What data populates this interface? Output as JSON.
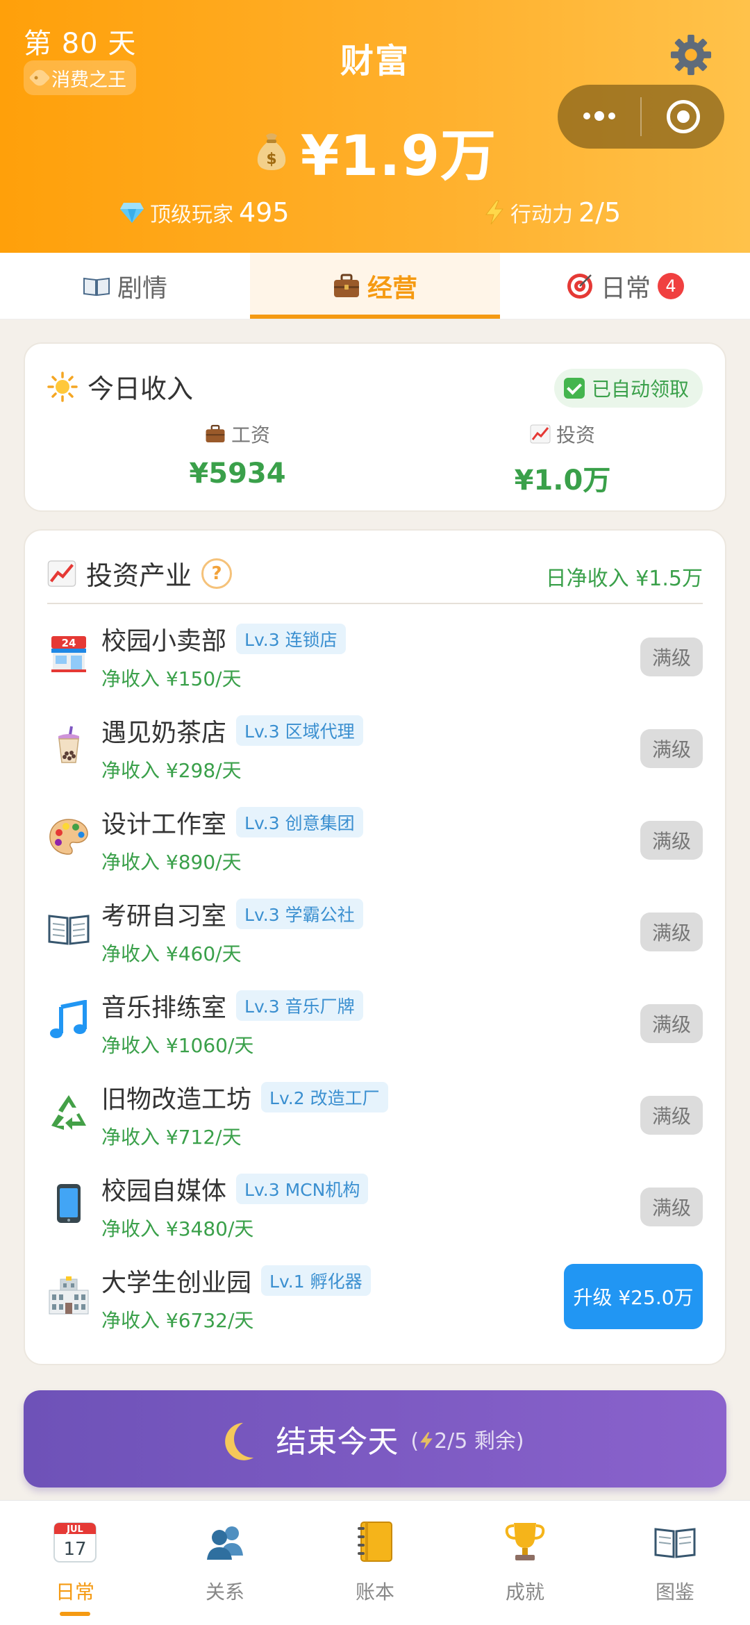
{
  "header": {
    "day_label": "第 80 天",
    "title_badge": "消费之王",
    "page_title": "财富",
    "money": "¥1.9万",
    "stat_left_label": "顶级玩家",
    "stat_left_value": "495",
    "stat_right_label": "行动力",
    "stat_right_value": "2/5"
  },
  "tabs": [
    {
      "label": "剧情",
      "icon": "book-icon"
    },
    {
      "label": "经营",
      "icon": "briefcase-icon",
      "active": true
    },
    {
      "label": "日常",
      "icon": "target-icon",
      "badge": "4"
    }
  ],
  "income": {
    "title": "今日收入",
    "auto_badge": "已自动领取",
    "salary_label": "工资",
    "salary_value": "¥5934",
    "invest_label": "投资",
    "invest_value": "¥1.0万"
  },
  "invest": {
    "title": "投资产业",
    "help": "?",
    "net_income": "日净收入 ¥1.5万",
    "items": [
      {
        "name": "校园小卖部",
        "level": "Lv.3 连锁店",
        "income": "净收入 ¥150/天",
        "action": "满级",
        "icon": "store-icon"
      },
      {
        "name": "遇见奶茶店",
        "level": "Lv.3 区域代理",
        "income": "净收入 ¥298/天",
        "action": "满级",
        "icon": "bubble-tea-icon"
      },
      {
        "name": "设计工作室",
        "level": "Lv.3 创意集团",
        "income": "净收入 ¥890/天",
        "action": "满级",
        "icon": "palette-icon"
      },
      {
        "name": "考研自习室",
        "level": "Lv.3 学霸公社",
        "income": "净收入 ¥460/天",
        "action": "满级",
        "icon": "book-icon"
      },
      {
        "name": "音乐排练室",
        "level": "Lv.3 音乐厂牌",
        "income": "净收入 ¥1060/天",
        "action": "满级",
        "icon": "music-note-icon"
      },
      {
        "name": "旧物改造工坊",
        "level": "Lv.2 改造工厂",
        "income": "净收入 ¥712/天",
        "action": "满级",
        "icon": "recycle-icon"
      },
      {
        "name": "校园自媒体",
        "level": "Lv.3 MCN机构",
        "income": "净收入 ¥3480/天",
        "action": "满级",
        "icon": "phone-icon"
      },
      {
        "name": "大学生创业园",
        "level": "Lv.1 孵化器",
        "income": "净收入 ¥6732/天",
        "action": "升级 ¥25.0万",
        "icon": "building-icon"
      }
    ]
  },
  "end_day": {
    "label": "结束今天",
    "sub_open": "(",
    "sub_value": "2/5 剩余",
    "sub_close": ")"
  },
  "bottom_nav": [
    {
      "label": "日常",
      "icon": "calendar-icon",
      "active": true,
      "calendar_month": "JUL",
      "calendar_day": "17"
    },
    {
      "label": "关系",
      "icon": "people-icon"
    },
    {
      "label": "账本",
      "icon": "notebook-icon"
    },
    {
      "label": "成就",
      "icon": "trophy-icon"
    },
    {
      "label": "图鉴",
      "icon": "book-icon"
    }
  ],
  "colors": {
    "header_orange": "#ffa00a",
    "accent": "#f59a12",
    "green": "#3aa04a",
    "blue": "#2196f3",
    "purple": "#7b5ac2"
  }
}
